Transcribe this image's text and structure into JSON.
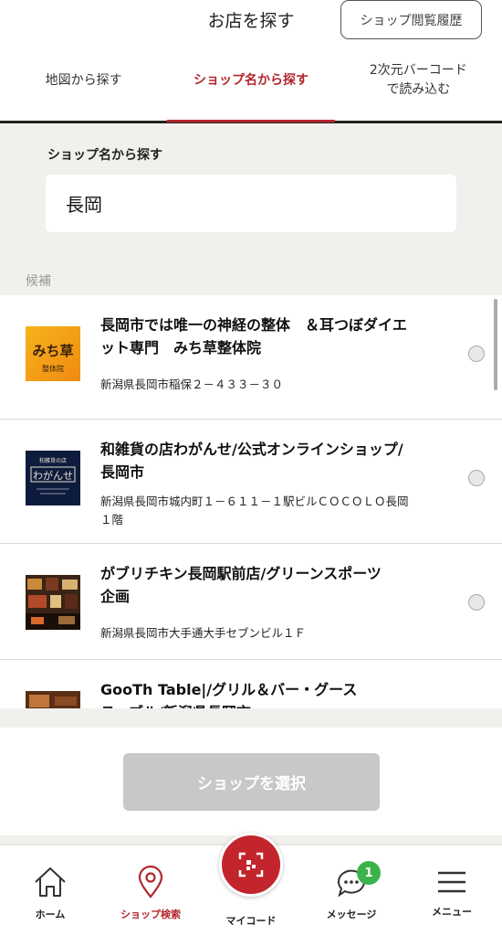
{
  "header": {
    "title": "お店を探す",
    "history_button": "ショップ閲覧履歴"
  },
  "tabs": [
    {
      "label": "地図から探す",
      "active": false
    },
    {
      "label": "ショップ名から探す",
      "active": true
    },
    {
      "label_line1": "2次元バーコード",
      "label_line2": "で読み込む",
      "active": false
    }
  ],
  "search": {
    "label": "ショップ名から探す",
    "value": "長岡"
  },
  "candidates_label": "候補",
  "results": [
    {
      "name_line1": "長岡市では唯一の神経の整体　＆耳つぼダイエ",
      "name_line2": "ット専門　みち草整体院",
      "address_line1": "新潟県長岡市稲保２－４３３－３０",
      "address_line2": "",
      "thumb_title": "みち草",
      "thumb_sub": "整体院"
    },
    {
      "name_line1": "和雑貨の店わがんせ/公式オンラインショップ/",
      "name_line2": "長岡市",
      "address_line1": "新潟県長岡市城内町１－６１１－１駅ビルＣＯＣＯＬＯ長岡",
      "address_line2": "１階",
      "thumb_title": "わがんせ",
      "thumb_sub": "和雑貨の店"
    },
    {
      "name_line1": "がブリチキン長岡駅前店/グリーンスポーツ",
      "name_line2": "企画",
      "address_line1": "新潟県長岡市大手通大手セブンビル１Ｆ",
      "address_line2": ""
    },
    {
      "name_line1": "GooTh Table|/グリル＆バー・グース",
      "name_line2": "テーブル/新潟県長岡市"
    }
  ],
  "select_button": "ショップを選択",
  "nav": {
    "home": "ホーム",
    "shop_search": "ショップ検索",
    "mycode": "マイコード",
    "message": "メッセージ",
    "message_badge": "1",
    "menu": "メニュー"
  },
  "colors": {
    "accent": "#b3272d",
    "badge": "#3bb34a",
    "disabled_button": "#c8c8c8"
  }
}
